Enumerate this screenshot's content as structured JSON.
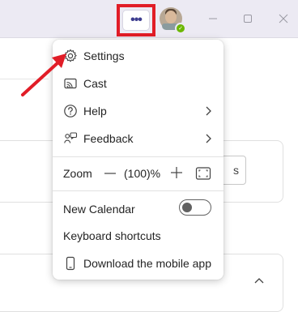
{
  "titlebar": {
    "more_button": "•••",
    "window_controls": [
      "minimize-icon",
      "maximize-icon",
      "close-icon"
    ],
    "avatar_status": "available"
  },
  "background": {
    "button_partial": "s"
  },
  "menu": {
    "settings": "Settings",
    "cast": "Cast",
    "help": "Help",
    "feedback": "Feedback",
    "zoom_label": "Zoom",
    "zoom_value": "(100)%",
    "new_calendar": "New Calendar",
    "new_calendar_enabled": false,
    "keyboard_shortcuts": "Keyboard shortcuts",
    "download_mobile": "Download the mobile app"
  },
  "annotation": {
    "highlight_color": "#e11d27",
    "arrow_color": "#e11d27"
  }
}
